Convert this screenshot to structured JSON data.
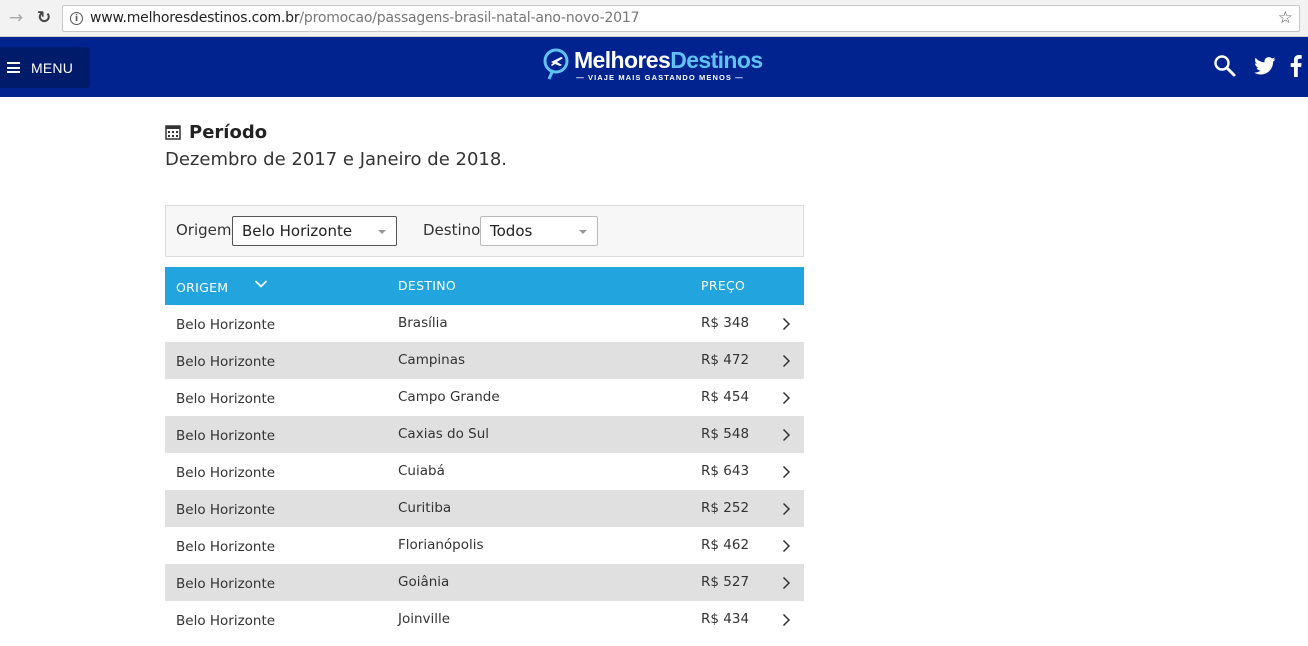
{
  "browser": {
    "url_domain": "www.melhoresdestinos.com.br",
    "url_path": "/promocao/passagens-brasil-natal-ano-novo-2017"
  },
  "header": {
    "menu_label": "MENU",
    "logo_word1": "Melhores",
    "logo_word2": "Destinos",
    "logo_tagline": "— VIAJE MAIS GASTANDO MENOS —",
    "accent": "#01238f",
    "logo_accent": "#5fc2f2"
  },
  "periodo": {
    "title": "Período",
    "value": "Dezembro de 2017 e Janeiro de 2018."
  },
  "filters": {
    "origem_label": "Origem:",
    "origem_value": "Belo Horizonte",
    "destino_label": "Destino:",
    "destino_value": "Todos"
  },
  "table": {
    "header_color": "#22a5de",
    "columns": [
      "ORIGEM",
      "DESTINO",
      "PREÇO"
    ],
    "rows": [
      {
        "origem": "Belo Horizonte",
        "destino": "Brasília",
        "preco": "R$ 348"
      },
      {
        "origem": "Belo Horizonte",
        "destino": "Campinas",
        "preco": "R$ 472"
      },
      {
        "origem": "Belo Horizonte",
        "destino": "Campo Grande",
        "preco": "R$ 454"
      },
      {
        "origem": "Belo Horizonte",
        "destino": "Caxias do Sul",
        "preco": "R$ 548"
      },
      {
        "origem": "Belo Horizonte",
        "destino": "Cuiabá",
        "preco": "R$ 643"
      },
      {
        "origem": "Belo Horizonte",
        "destino": "Curitiba",
        "preco": "R$ 252"
      },
      {
        "origem": "Belo Horizonte",
        "destino": "Florianópolis",
        "preco": "R$ 462"
      },
      {
        "origem": "Belo Horizonte",
        "destino": "Goiânia",
        "preco": "R$ 527"
      },
      {
        "origem": "Belo Horizonte",
        "destino": "Joinville",
        "preco": "R$ 434"
      }
    ]
  }
}
